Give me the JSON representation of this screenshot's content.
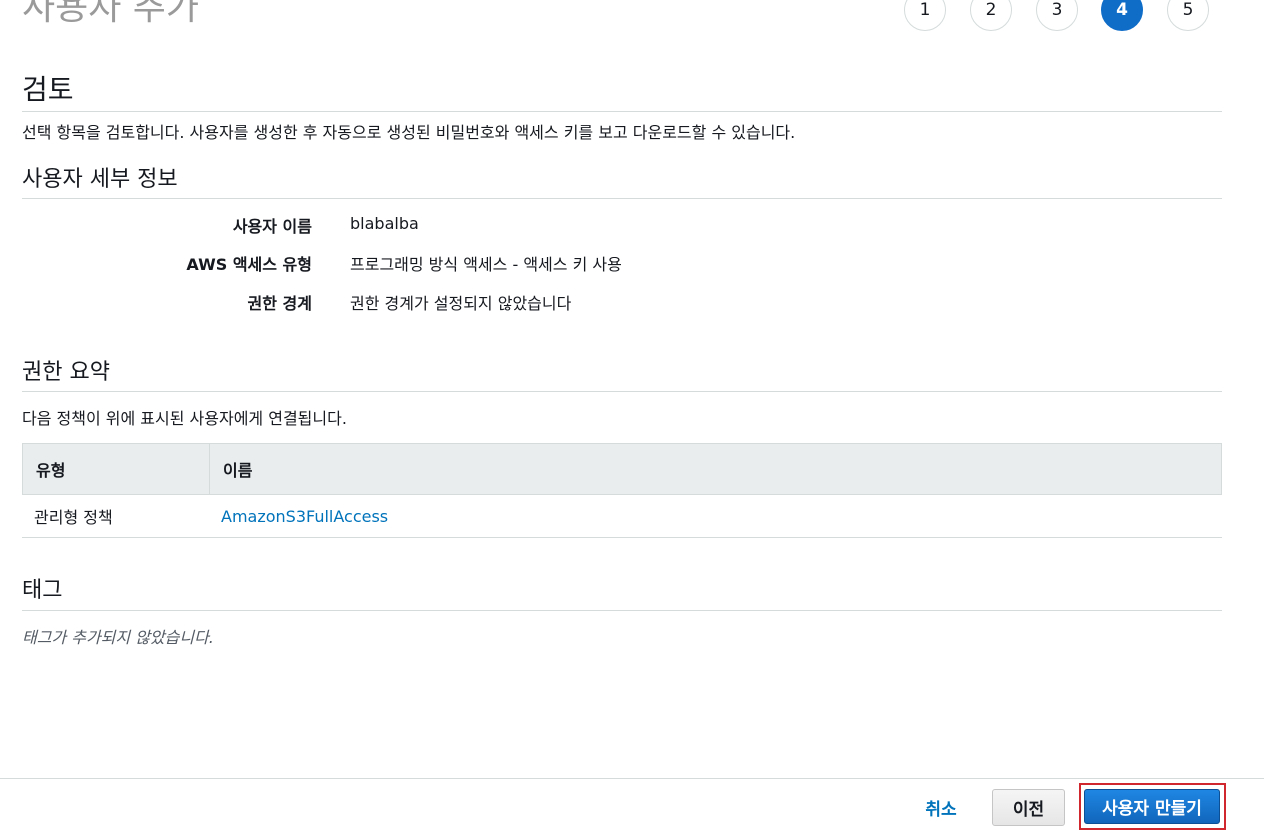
{
  "header": {
    "title": "사용자 추가",
    "steps": [
      "1",
      "2",
      "3",
      "4",
      "5"
    ],
    "active_step": "4"
  },
  "review": {
    "title": "검토",
    "description": "선택 항목을 검토합니다. 사용자를 생성한 후 자동으로 생성된 비밀번호와 액세스 키를 보고 다운로드할 수 있습니다."
  },
  "user_details": {
    "title": "사용자 세부 정보",
    "rows": [
      {
        "label": "사용자 이름",
        "value": "blabalba"
      },
      {
        "label": "AWS 액세스 유형",
        "value": "프로그래밍 방식 액세스 - 액세스 키 사용"
      },
      {
        "label": "권한 경계",
        "value": "권한 경계가 설정되지 않았습니다"
      }
    ]
  },
  "permissions": {
    "title": "권한 요약",
    "description": "다음 정책이 위에 표시된 사용자에게 연결됩니다.",
    "columns": [
      "유형",
      "이름"
    ],
    "rows": [
      {
        "type": "관리형 정책",
        "name": "AmazonS3FullAccess"
      }
    ]
  },
  "tags": {
    "title": "태그",
    "empty_text": "태그가 추가되지 않았습니다."
  },
  "footer": {
    "cancel_label": "취소",
    "previous_label": "이전",
    "create_label": "사용자 만들기"
  },
  "colors": {
    "primary": "#0f6dc8",
    "link": "#0073bb",
    "highlight_border": "#d0262d"
  }
}
